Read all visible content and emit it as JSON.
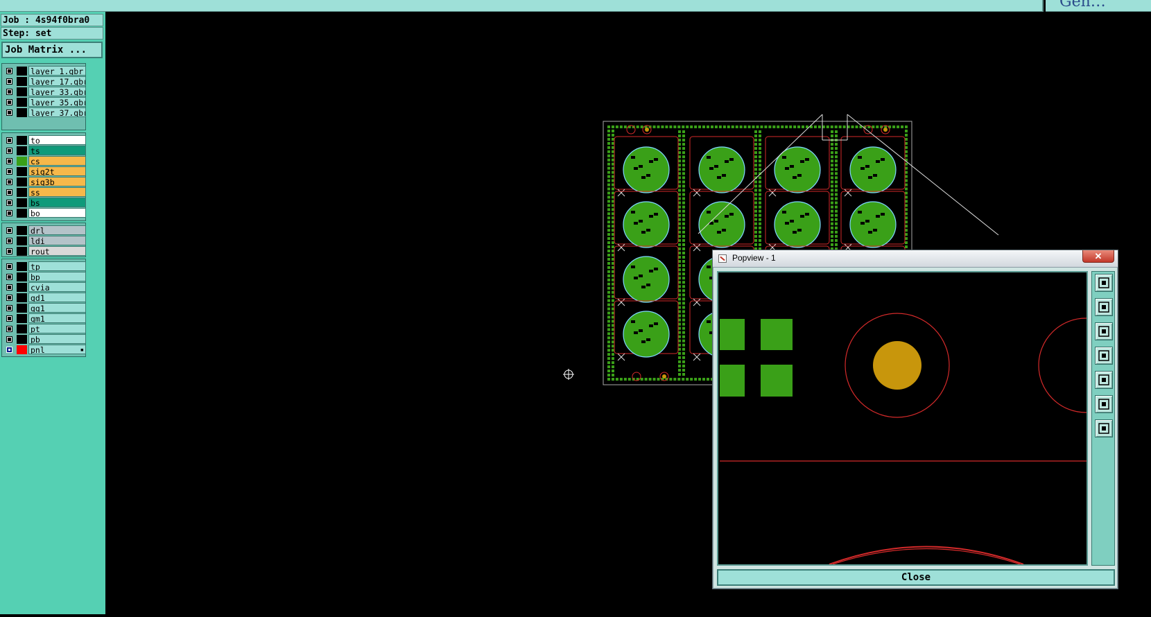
{
  "header": {
    "job_label": "Job : 4s94f0bra0",
    "step_label": "Step: set",
    "job_matrix_button": "Job Matrix ...",
    "top_right_text": "Gen…"
  },
  "layers": {
    "group1": [
      {
        "name": "layer_1.gbr",
        "color": "#9ee0d8"
      },
      {
        "name": "layer_17.gbr",
        "color": "#9ee0d8"
      },
      {
        "name": "layer_33.gbr",
        "color": "#9ee0d8"
      },
      {
        "name": "layer_35.gbr",
        "color": "#9ee0d8"
      },
      {
        "name": "layer_37.gbr",
        "color": "#9ee0d8"
      }
    ],
    "group2": [
      {
        "name": "to",
        "color": "#ffffff",
        "swatch": "#000000"
      },
      {
        "name": "ts",
        "color": "#0f9a7a",
        "swatch": "#000000"
      },
      {
        "name": "cs",
        "color": "#f7b84a",
        "swatch": "#3aa018"
      },
      {
        "name": "sig2t",
        "color": "#f7b84a",
        "swatch": "#000000"
      },
      {
        "name": "sig3b",
        "color": "#f7b84a",
        "swatch": "#000000"
      },
      {
        "name": "ss",
        "color": "#f7b84a",
        "swatch": "#000000"
      },
      {
        "name": "bs",
        "color": "#0f9a7a",
        "swatch": "#000000"
      },
      {
        "name": "bo",
        "color": "#ffffff",
        "swatch": "#000000"
      }
    ],
    "group3": [
      {
        "name": "drl",
        "color": "#b4c3c9"
      },
      {
        "name": "ldi",
        "color": "#b4c3c9"
      },
      {
        "name": "rout",
        "color": "#d9d9d9"
      }
    ],
    "group4": [
      {
        "name": "tp",
        "color": "#9ee0d8"
      },
      {
        "name": "bp",
        "color": "#9ee0d8"
      },
      {
        "name": "cvia",
        "color": "#9ee0d8"
      },
      {
        "name": "gd1",
        "color": "#9ee0d8"
      },
      {
        "name": "gg1",
        "color": "#9ee0d8"
      },
      {
        "name": "gm1",
        "color": "#9ee0d8"
      },
      {
        "name": "pt",
        "color": "#9ee0d8"
      },
      {
        "name": "pb",
        "color": "#9ee0d8"
      },
      {
        "name": "pnl",
        "color": "#9ee0d8",
        "swatch": "#ff0000",
        "selected": true,
        "mark": "▪"
      }
    ]
  },
  "popview": {
    "title": "Popview - 1",
    "close_x": "✕",
    "close_button": "Close",
    "tools": [
      "zoom-window-icon",
      "pan-up-icon",
      "pan-down-icon",
      "pan-left-icon",
      "pan-right-icon",
      "zoom-fit-icon",
      "zoom-home-icon"
    ]
  },
  "colors": {
    "copper": "#3aa018",
    "outline": "#d42a2a",
    "mask": "#c8960c",
    "circle_outline": "#7fd7ff"
  }
}
